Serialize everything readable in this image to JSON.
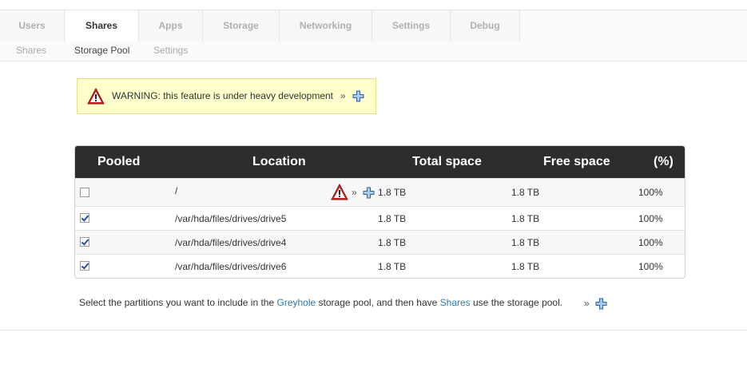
{
  "main_tabs": [
    {
      "label": "Users",
      "active": false
    },
    {
      "label": "Shares",
      "active": true
    },
    {
      "label": "Apps",
      "active": false
    },
    {
      "label": "Storage",
      "active": false
    },
    {
      "label": "Networking",
      "active": false
    },
    {
      "label": "Settings",
      "active": false
    },
    {
      "label": "Debug",
      "active": false
    }
  ],
  "sub_tabs": [
    {
      "label": "Shares",
      "active": false
    },
    {
      "label": "Storage Pool",
      "active": true
    },
    {
      "label": "Settings",
      "active": false
    }
  ],
  "warning": {
    "text": "WARNING: this feature is under heavy development",
    "more": "»",
    "icon": "warning-triangle-icon",
    "expand_icon": "plus-icon"
  },
  "table": {
    "headers": {
      "pooled": "Pooled",
      "location": "Location",
      "total": "Total space",
      "free": "Free space",
      "percent": "(%)"
    },
    "rows": [
      {
        "pooled": false,
        "location": "/",
        "warn": true,
        "more": "»",
        "total": "1.8 TB",
        "free": "1.8 TB",
        "percent": "100%"
      },
      {
        "pooled": true,
        "location": "/var/hda/files/drives/drive5",
        "warn": false,
        "more": "",
        "total": "1.8 TB",
        "free": "1.8 TB",
        "percent": "100%"
      },
      {
        "pooled": true,
        "location": "/var/hda/files/drives/drive4",
        "warn": false,
        "more": "",
        "total": "1.8 TB",
        "free": "1.8 TB",
        "percent": "100%"
      },
      {
        "pooled": true,
        "location": "/var/hda/files/drives/drive6",
        "warn": false,
        "more": "",
        "total": "1.8 TB",
        "free": "1.8 TB",
        "percent": "100%"
      }
    ]
  },
  "footer": {
    "part1": "Select the partitions you want to include in the ",
    "link1": "Greyhole",
    "part2": " storage pool, and then have ",
    "link2": "Shares",
    "part3": " use the storage pool.",
    "more": "»"
  },
  "colors": {
    "accent_link": "#2a7ab0",
    "header_bg": "#2d2d2d",
    "warning_bg": "#ffffcc",
    "warning_red": "#cc2222"
  }
}
